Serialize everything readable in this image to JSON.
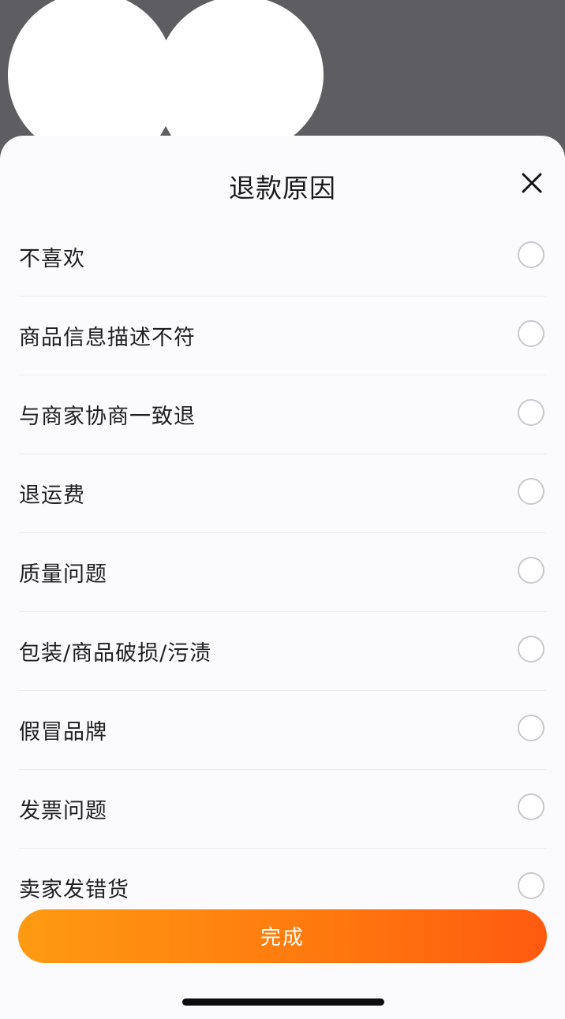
{
  "sheet": {
    "title": "退款原因",
    "close_icon": "close-icon"
  },
  "reasons": [
    {
      "label": "不喜欢",
      "selected": false
    },
    {
      "label": "商品信息描述不符",
      "selected": false
    },
    {
      "label": "与商家协商一致退",
      "selected": false
    },
    {
      "label": "退运费",
      "selected": false
    },
    {
      "label": "质量问题",
      "selected": false
    },
    {
      "label": "包装/商品破损/污渍",
      "selected": false
    },
    {
      "label": "假冒品牌",
      "selected": false
    },
    {
      "label": "发票问题",
      "selected": false
    },
    {
      "label": "卖家发错货",
      "selected": false
    }
  ],
  "footer": {
    "done_label": "完成"
  },
  "colors": {
    "accent_start": "#ff9a12",
    "accent_end": "#ff5a10",
    "backdrop": "#5e5d61"
  }
}
